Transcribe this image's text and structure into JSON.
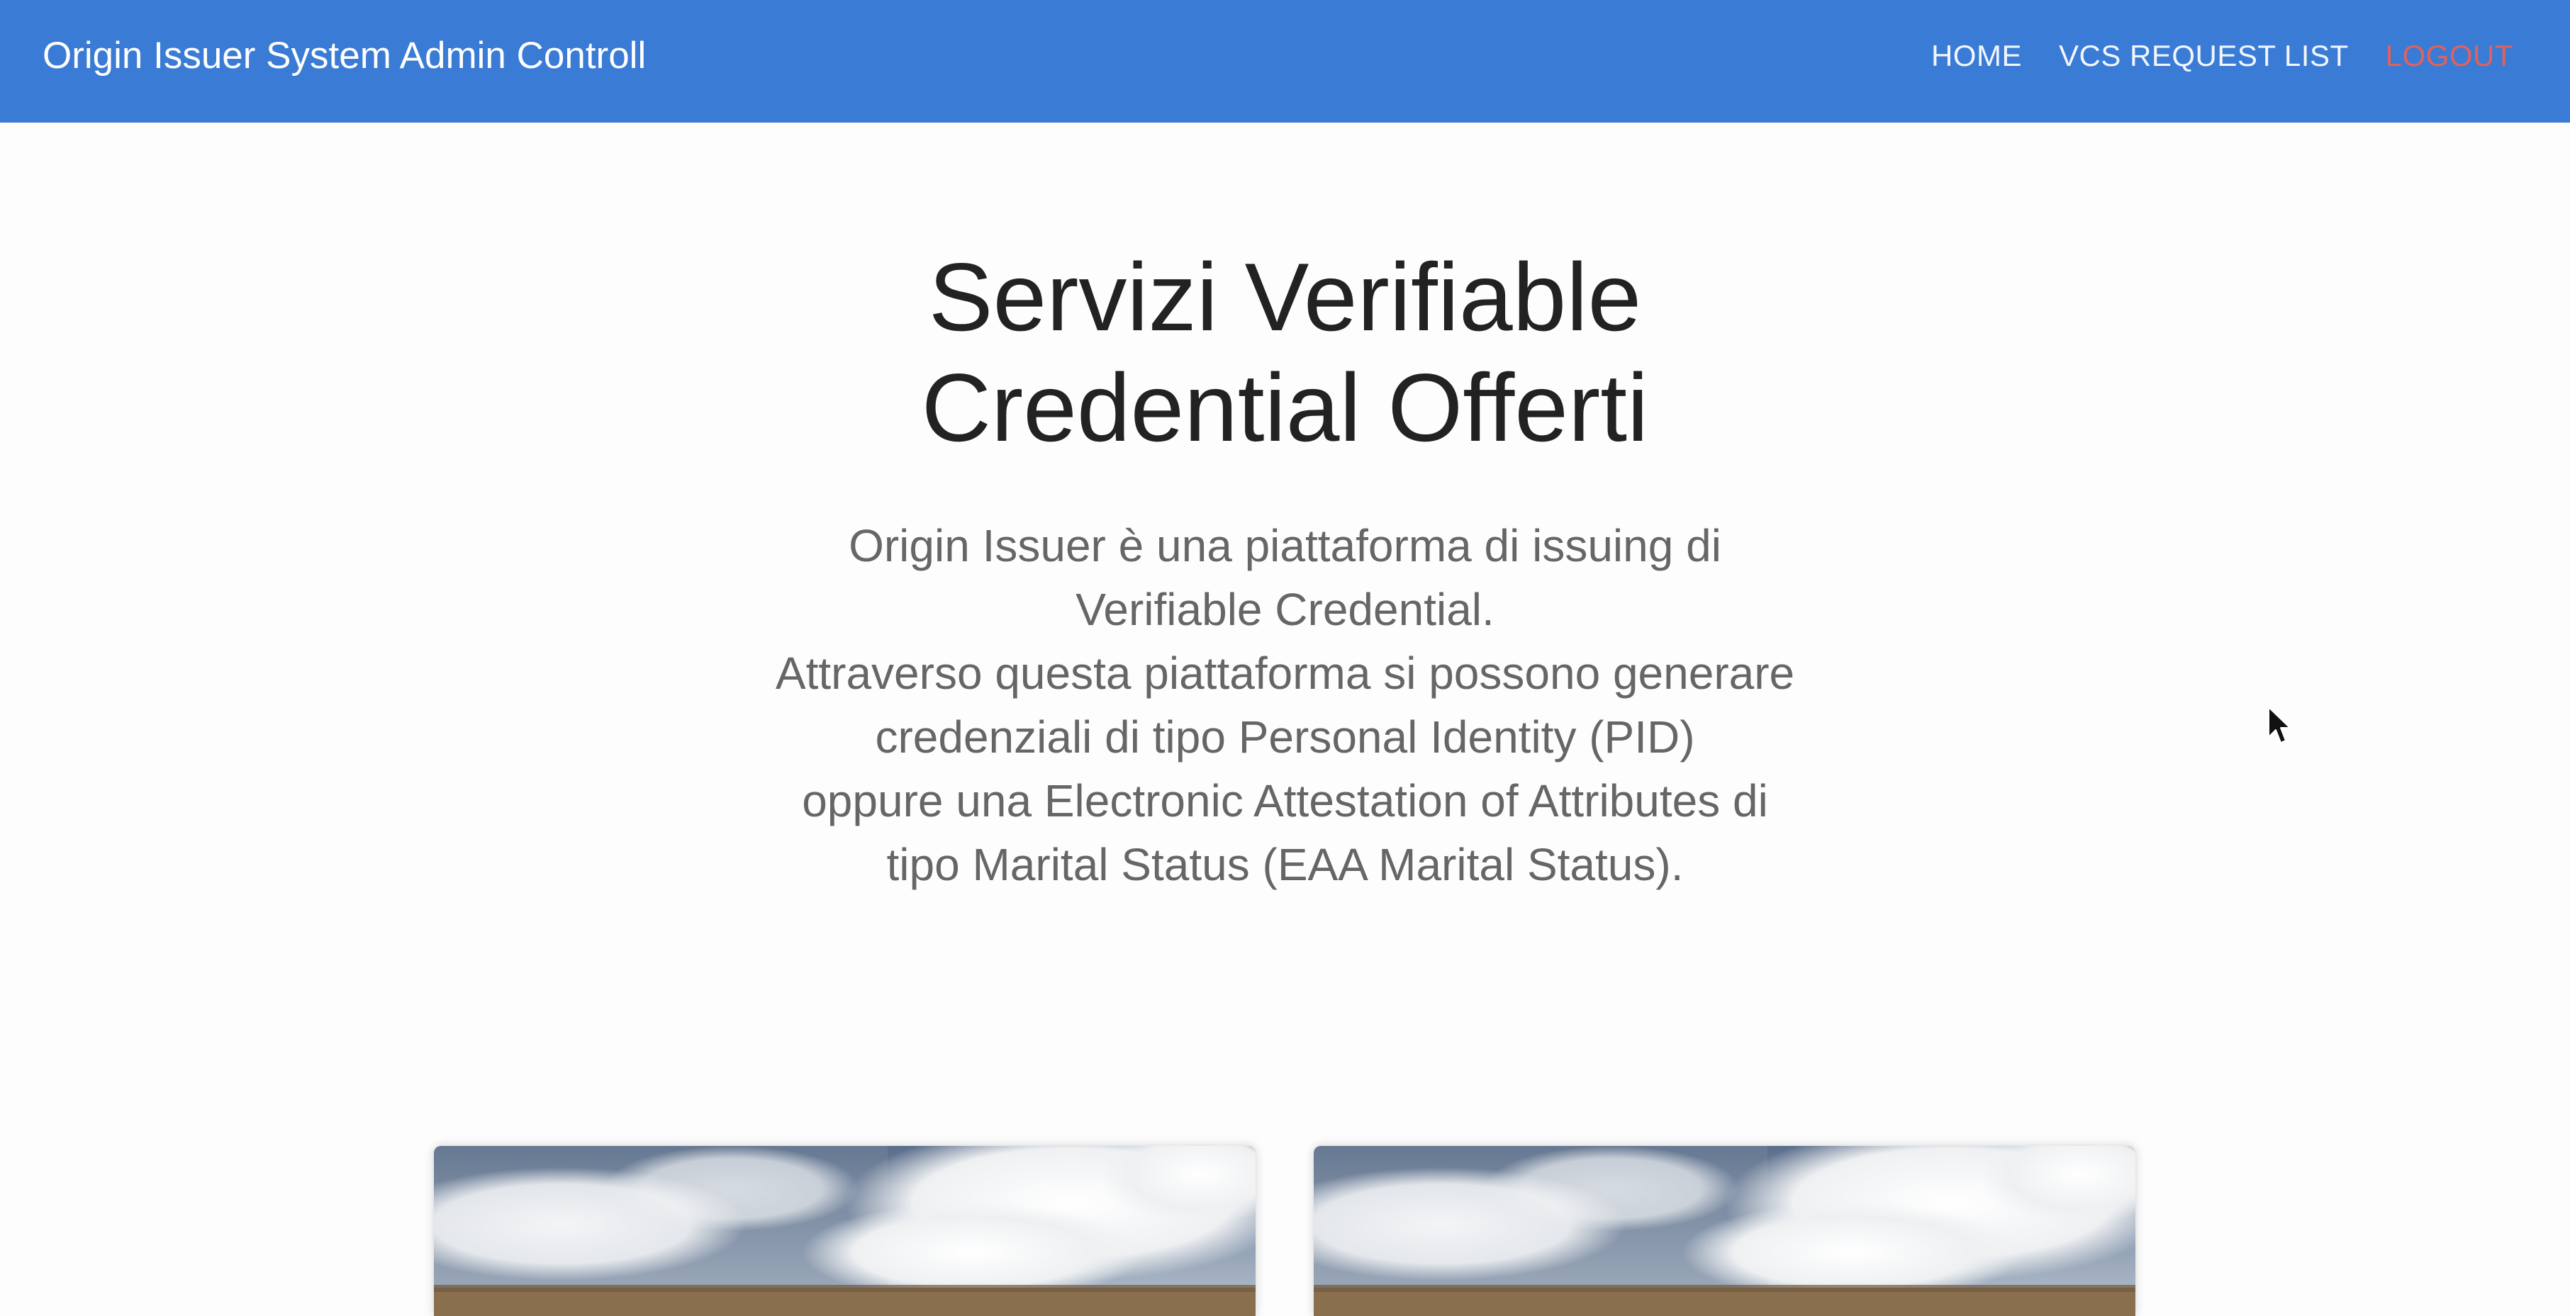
{
  "navbar": {
    "brand": "Origin Issuer System Admin Controll",
    "links": [
      {
        "label": "HOME"
      },
      {
        "label": "VCS REQUEST LIST"
      },
      {
        "label": "LOGOUT"
      }
    ],
    "colors": {
      "background": "#3a7bd5",
      "logout": "#e2615b"
    }
  },
  "hero": {
    "title_line1": "Servizi Verifiable",
    "title_line2": "Credential Offerti",
    "lead_lines": [
      "Origin Issuer è una piattaforma di issuing di",
      "Verifiable Credential.",
      "Attraverso questa piattaforma si possono generare",
      "credenziali di tipo Personal Identity (PID)",
      "oppure una Electronic Attestation of Attributes di",
      "tipo Marital Status (EAA Marital Status)."
    ]
  },
  "cards": [
    {
      "image": "sky-clouds-field-image"
    },
    {
      "image": "sky-clouds-field-image"
    }
  ],
  "cursor": {
    "icon": "mouse-pointer-icon"
  }
}
